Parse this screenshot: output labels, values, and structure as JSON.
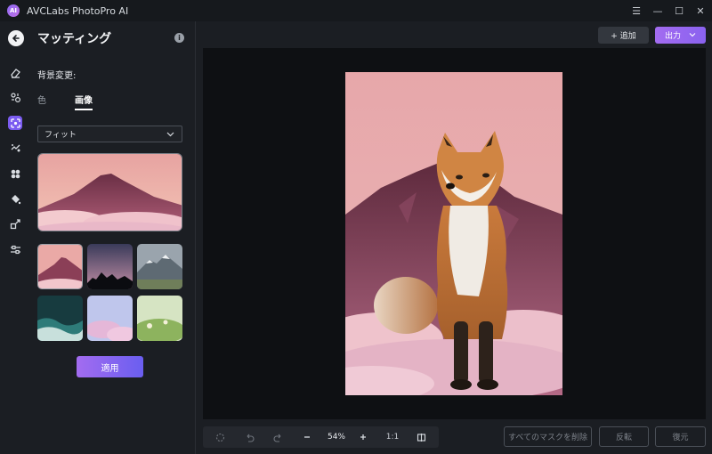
{
  "app": {
    "title": "AVCLabs PhotoPro AI",
    "logo_text": "AI"
  },
  "window": {
    "menu": "☰",
    "minimize": "—",
    "maximize": "☐",
    "close": "✕"
  },
  "rail": {
    "items": [
      {
        "icon": "eraser-icon"
      },
      {
        "icon": "portrait-icon"
      },
      {
        "icon": "matting-icon",
        "active": true
      },
      {
        "icon": "photo-enhance-icon"
      },
      {
        "icon": "colorize-icon"
      },
      {
        "icon": "fill-icon"
      },
      {
        "icon": "resize-icon"
      },
      {
        "icon": "adjust-icon"
      }
    ]
  },
  "panel": {
    "title": "マッティング",
    "section_label": "背景変更:",
    "tabs": {
      "color": "色",
      "image": "画像"
    },
    "fit_select": {
      "value": "フィット"
    },
    "apply_label": "適用"
  },
  "topbar": {
    "add_label": "+ 追加",
    "export_label": "出力"
  },
  "bottombar": {
    "zoom": "54%",
    "ratio": "1:1"
  },
  "actions": {
    "remove_all_masks": "すべてのマスクを削除",
    "invert": "反転",
    "restore": "復元"
  },
  "colors": {
    "accent": "#7b5cf0",
    "panel_bg": "#1b1e23",
    "canvas_bg": "#0e1013"
  }
}
